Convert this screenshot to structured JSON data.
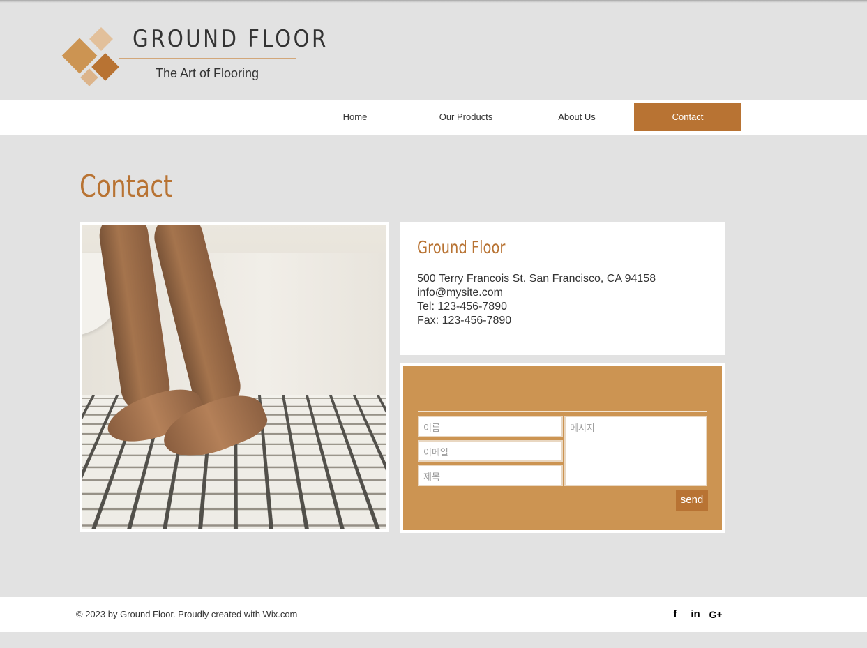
{
  "brand": {
    "title": "GROUND FLOOR",
    "tagline": "The Art of Flooring",
    "colors": {
      "accent": "#b87333",
      "tan": "#cc9452",
      "light_tan": "#e2c09b"
    }
  },
  "nav": {
    "items": [
      {
        "label": "Home"
      },
      {
        "label": "Our Products"
      },
      {
        "label": "About Us"
      },
      {
        "label": "Contact",
        "active": true
      }
    ]
  },
  "page": {
    "title": "Contact"
  },
  "photo": {
    "description_icon": "feet-on-tile-floor-photo"
  },
  "info": {
    "name": "Ground Floor",
    "address": "500 Terry Francois St. San Francisco, CA 94158",
    "email": "info@mysite.com",
    "tel": "Tel: 123-456-7890",
    "fax": "Fax: 123-456-7890"
  },
  "form": {
    "name_placeholder": "이름",
    "email_placeholder": "이메일",
    "subject_placeholder": "제목",
    "message_placeholder": "메시지",
    "send_label": "send"
  },
  "footer": {
    "copyright": "© 2023 by Ground Floor. Proudly created with Wix.com",
    "social": [
      {
        "icon": "facebook-icon",
        "glyph": "f"
      },
      {
        "icon": "linkedin-icon",
        "glyph": "in"
      },
      {
        "icon": "google-plus-icon",
        "glyph": "G+"
      }
    ]
  }
}
